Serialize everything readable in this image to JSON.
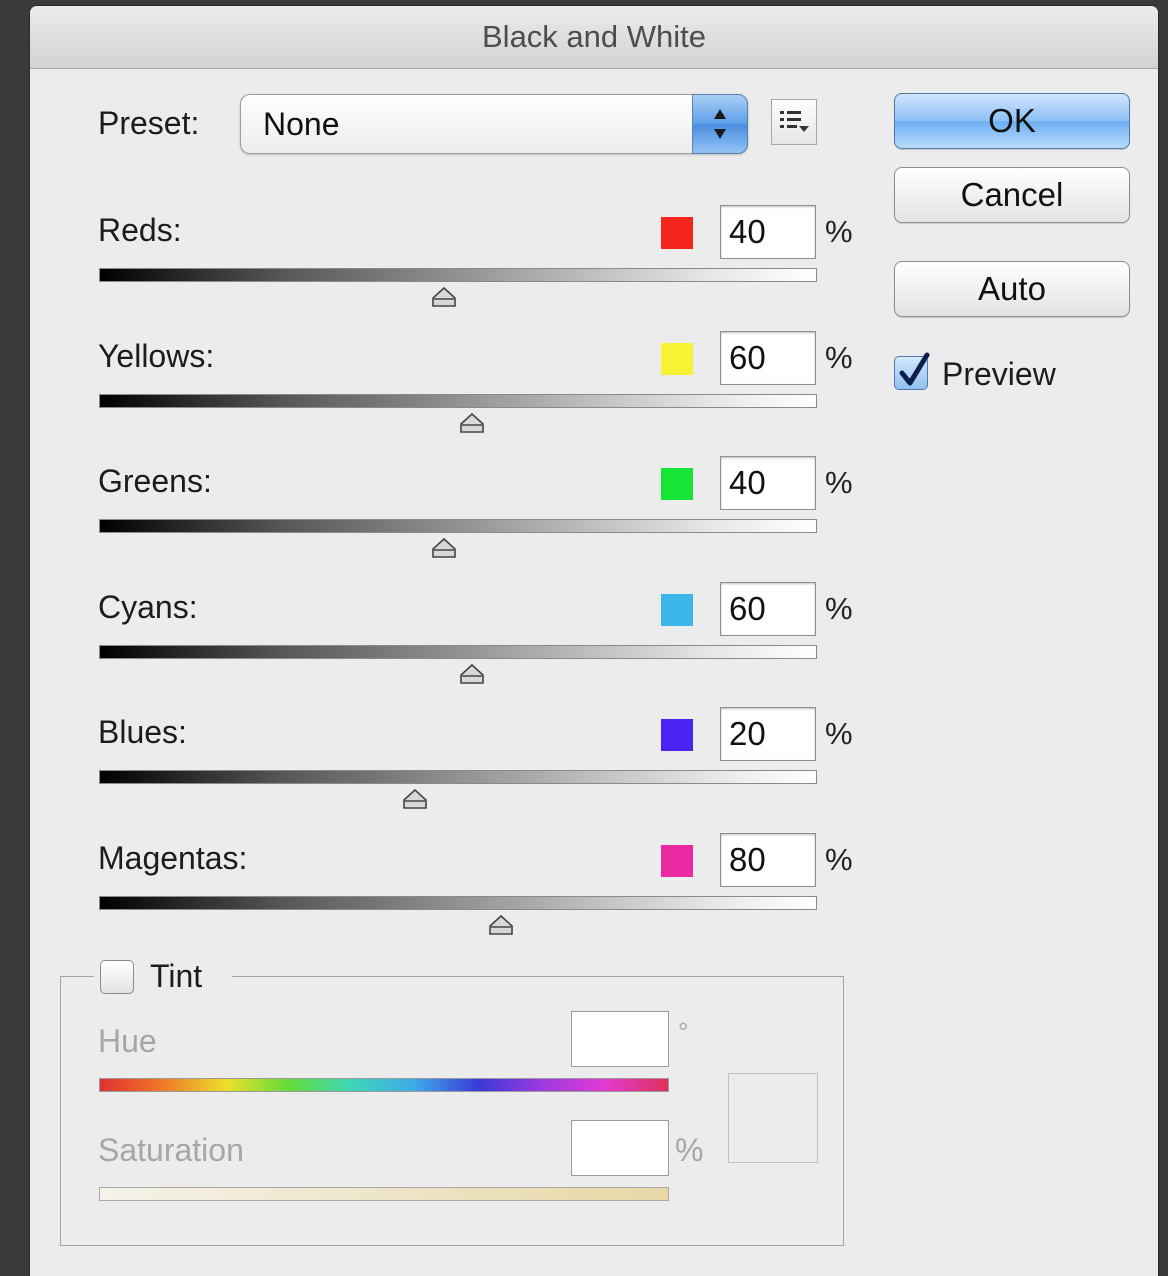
{
  "window": {
    "title": "Black and White"
  },
  "preset": {
    "label": "Preset:",
    "value": "None"
  },
  "channels": [
    {
      "label": "Reds:",
      "value": "40",
      "unit": "%",
      "color": "#f4261c",
      "slider_fraction": 0.48
    },
    {
      "label": "Yellows:",
      "value": "60",
      "unit": "%",
      "color": "#f7f234",
      "slider_fraction": 0.52
    },
    {
      "label": "Greens:",
      "value": "40",
      "unit": "%",
      "color": "#16e436",
      "slider_fraction": 0.48
    },
    {
      "label": "Cyans:",
      "value": "60",
      "unit": "%",
      "color": "#3ab6ea",
      "slider_fraction": 0.52
    },
    {
      "label": "Blues:",
      "value": "20",
      "unit": "%",
      "color": "#4a22f2",
      "slider_fraction": 0.44
    },
    {
      "label": "Magentas:",
      "value": "80",
      "unit": "%",
      "color": "#ea2aa2",
      "slider_fraction": 0.56
    }
  ],
  "buttons": {
    "ok": "OK",
    "cancel": "Cancel",
    "auto": "Auto"
  },
  "preview": {
    "label": "Preview",
    "checked": true
  },
  "tint": {
    "label": "Tint",
    "checked": false,
    "hue_label": "Hue",
    "hue_unit": "°",
    "saturation_label": "Saturation",
    "saturation_unit": "%"
  }
}
